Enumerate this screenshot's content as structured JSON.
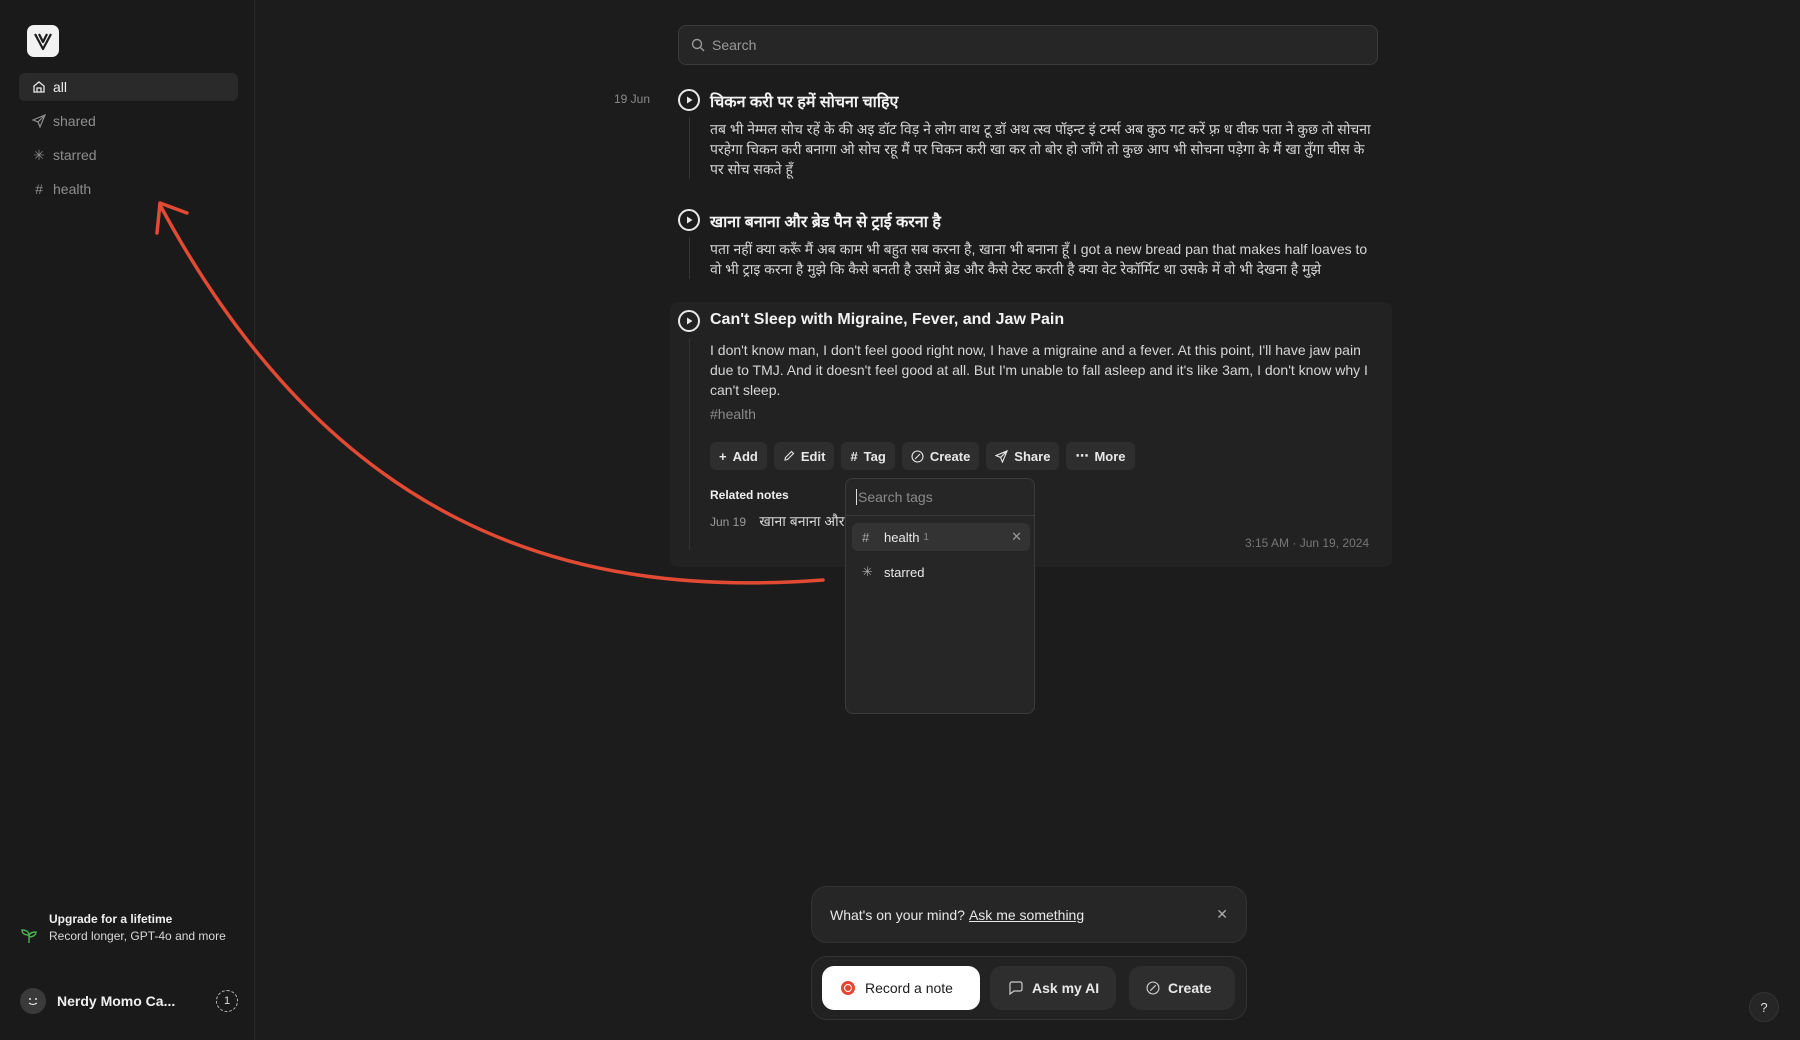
{
  "sidebar": {
    "items": [
      {
        "label": "all",
        "icon": "home-icon",
        "active": true
      },
      {
        "label": "shared",
        "icon": "send-icon"
      },
      {
        "label": "starred",
        "icon": "asterisk-icon"
      },
      {
        "label": "health",
        "icon": "hash-icon"
      }
    ],
    "upgrade": {
      "title": "Upgrade for a lifetime",
      "text": "Record longer, GPT-4o and more"
    },
    "user": {
      "name": "Nerdy Momo Ca...",
      "badge": "1"
    }
  },
  "search": {
    "placeholder": "Search"
  },
  "date_label": "19 Jun",
  "notes": [
    {
      "title": "चिकन करी पर हमें सोचना चाहिए",
      "body": "तब भी नेम्मल सोच रहें के की अइ डॉट विड़ ने लोग वाथ टू डॉ अथ त्स्व पॉइन्ट इं टर्म्स अब कुठ गट करें फ़्र ध वीक पता ने कुछ तो सोचना परहेगा चिकन करी बनागा ओ सोच रहू मैं पर चिकन करी खा कर तो बोर हो जाँगे तो कुछ आप भी सोचना पड़ेगा के मैं खा तुँगा चीस के पर सोच सकते हूँ"
    },
    {
      "title": "खाना बनाना और ब्रेड पैन से ट्राई करना है",
      "body": "पता नहीं क्या करूँ मैं अब काम भी बहुत सब करना है, खाना भी बनाना हूँ I got a new bread pan that makes half loaves to वो भी ट्राइ करना है मुझे कि कैसे बनती है उसमें ब्रेड और कैसे टेस्ट करती है क्या वेट रेकॉर्मिट था उसके में वो भी देखना है मुझे"
    },
    {
      "title": "Can't Sleep with Migraine, Fever, and Jaw Pain",
      "body": "I don't know man, I don't feel good right now, I have a migraine and a fever. At this point, I'll have jaw pain due to TMJ. And it doesn't feel good at all. But I'm unable to fall asleep and it's like 3am, I don't know why I can't sleep.",
      "tag": "health",
      "timestamp": "3:15 AM · Jun 19, 2024"
    }
  ],
  "actions": [
    {
      "label": "Add",
      "icon": "plus-icon"
    },
    {
      "label": "Edit",
      "icon": "pencil-icon"
    },
    {
      "label": "Tag",
      "icon": "hash-icon"
    },
    {
      "label": "Create",
      "icon": "sparkle-icon"
    },
    {
      "label": "Share",
      "icon": "send-icon"
    },
    {
      "label": "More",
      "icon": "ellipsis-icon"
    }
  ],
  "related": {
    "heading": "Related notes",
    "date": "Jun 19",
    "title": "खाना बनाना और"
  },
  "tag_dropdown": {
    "placeholder": "Search tags",
    "items": [
      {
        "label": "health",
        "count": "1",
        "icon": "hash-icon",
        "selected": true
      },
      {
        "label": "starred",
        "icon": "asterisk-icon"
      }
    ]
  },
  "prompt": {
    "text": "What's on your mind?",
    "link": "Ask me something"
  },
  "bottom_bar": {
    "record": "Record a note",
    "ask": "Ask my AI",
    "create": "Create"
  },
  "help": "?",
  "colors": {
    "accent_red": "#e64533",
    "annotation_arrow": "#e24a33"
  }
}
